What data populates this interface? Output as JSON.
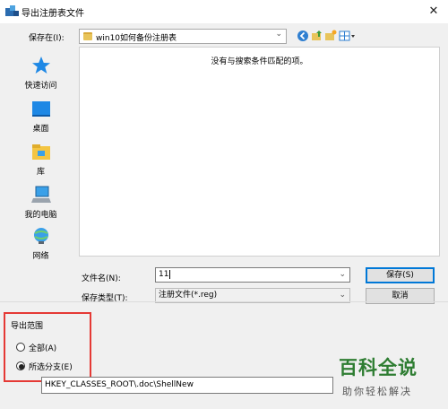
{
  "window": {
    "title": "导出注册表文件",
    "close_glyph": "✕"
  },
  "save_in": {
    "label": "保存在(I):",
    "value": "win10如何备份注册表",
    "arrow": "⌄"
  },
  "toolbar": {
    "back_glyph": "◀",
    "up_glyph": "⬆",
    "new_folder_glyph": "✱",
    "view_glyph": "▦▾"
  },
  "places": [
    {
      "label": "快速访问",
      "icon": "star-icon"
    },
    {
      "label": "桌面",
      "icon": "desktop-icon"
    },
    {
      "label": "库",
      "icon": "library-icon"
    },
    {
      "label": "我的电脑",
      "icon": "computer-icon"
    },
    {
      "label": "网络",
      "icon": "network-icon"
    }
  ],
  "file_list": {
    "empty_message": "没有与搜索条件匹配的项。"
  },
  "file_name": {
    "label": "文件名(N):",
    "value": "11",
    "arrow": "⌄"
  },
  "save_type": {
    "label": "保存类型(T):",
    "value": "注册文件(*.reg)",
    "arrow": "⌄"
  },
  "buttons": {
    "save": "保存(S)",
    "cancel": "取消"
  },
  "export_range": {
    "title": "导出范围",
    "options": [
      {
        "label": "全部(A)",
        "checked": false
      },
      {
        "label": "所选分支(E)",
        "checked": true
      }
    ],
    "path": "HKEY_CLASSES_ROOT\\.doc\\ShellNew"
  },
  "watermark": {
    "title": "百科全说",
    "subtitle": "助你轻松解决"
  },
  "colors": {
    "highlight_border": "#e53935",
    "accent": "#0078d7",
    "watermark": "#2e7d32"
  }
}
